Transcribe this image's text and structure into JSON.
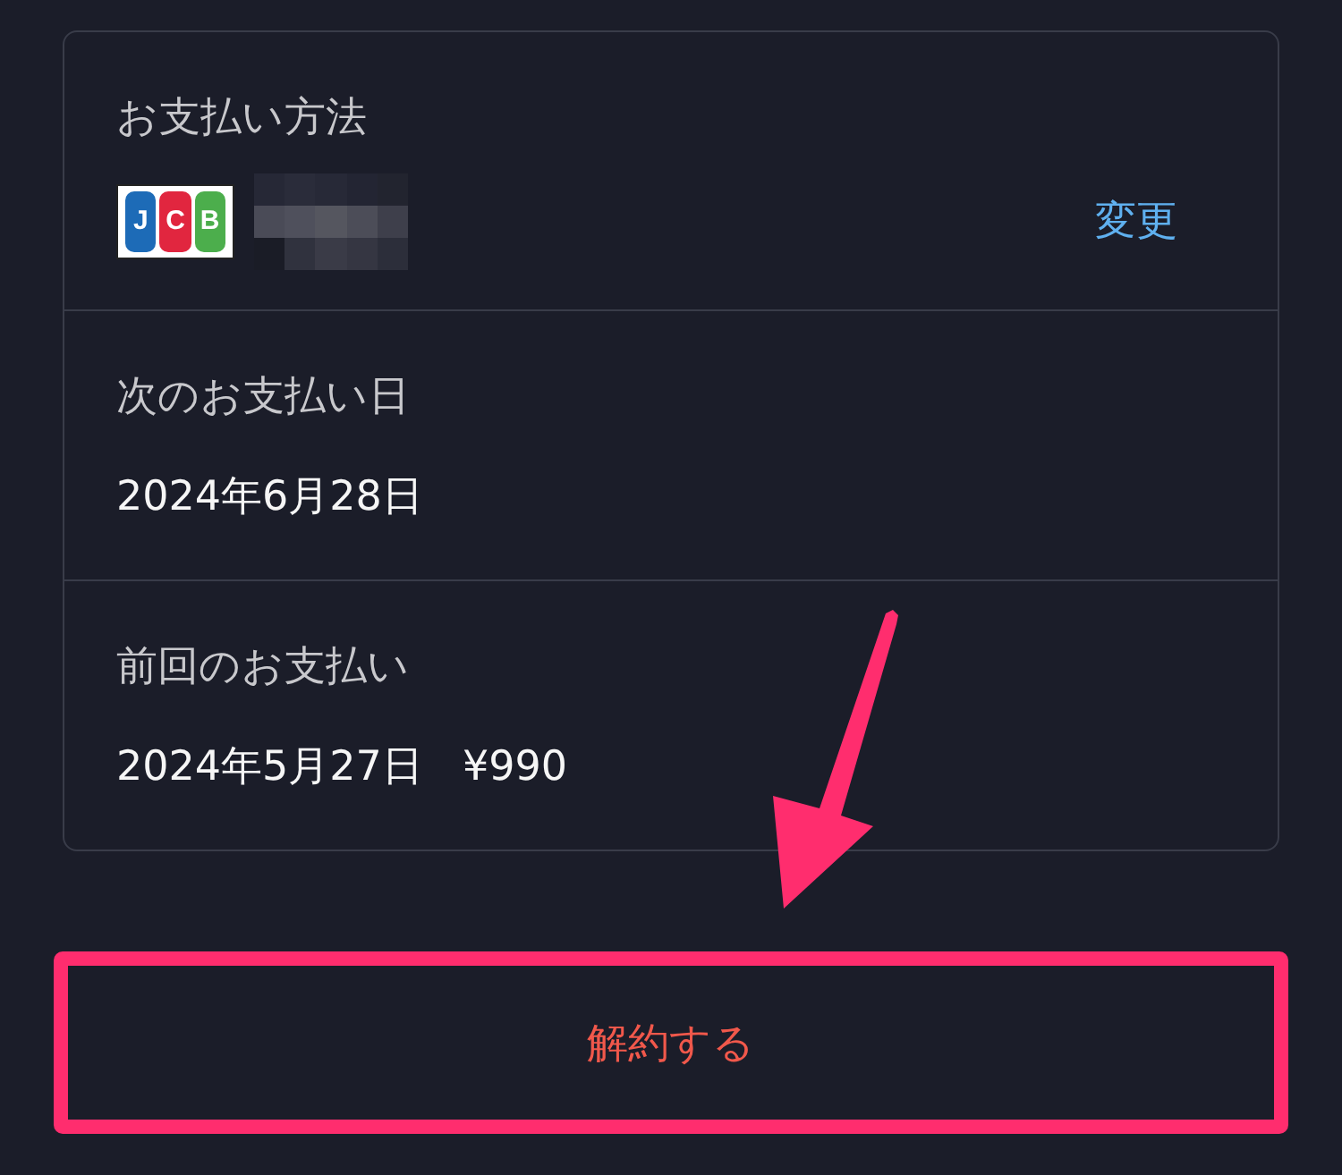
{
  "payment_method": {
    "label": "お支払い方法",
    "brand_letters": [
      "J",
      "C",
      "B"
    ],
    "card_number_masked": true,
    "change_link": "変更"
  },
  "next_payment": {
    "label": "次のお支払い日",
    "date": "2024年6月28日"
  },
  "last_payment": {
    "label": "前回のお支払い",
    "date": "2024年5月27日",
    "amount": "¥990"
  },
  "cancel_button": {
    "label": "解約する",
    "highlighted": true
  },
  "annotations": [
    {
      "kind": "arrow"
    }
  ]
}
